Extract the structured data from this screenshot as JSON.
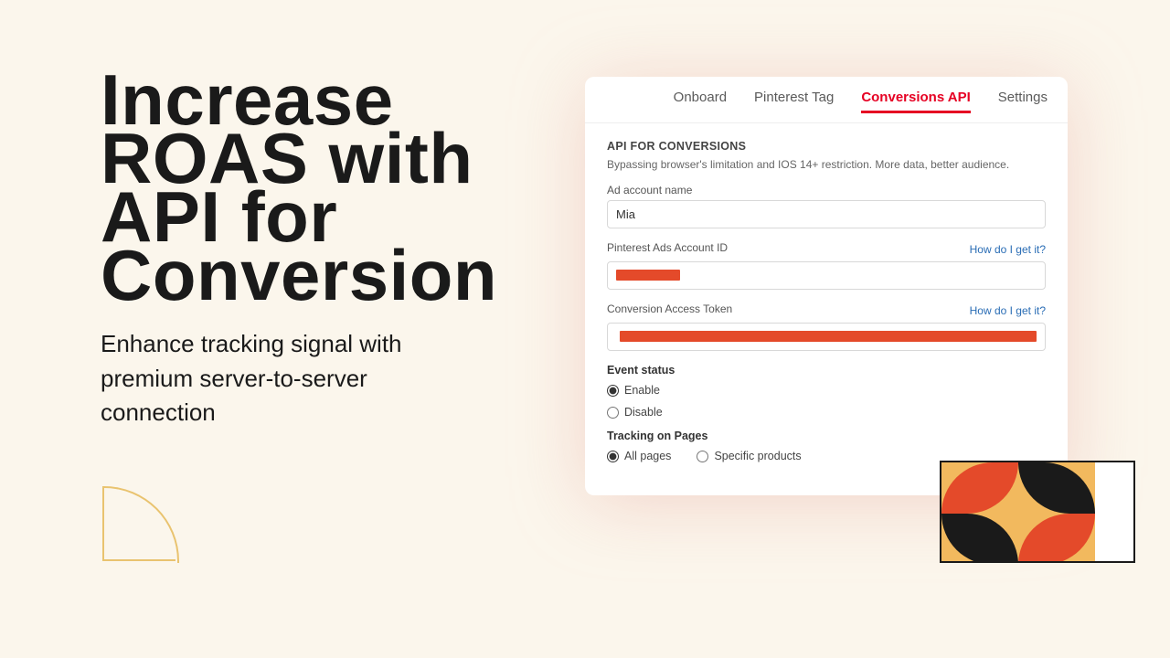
{
  "hero": {
    "headline": "Increase ROAS with API for Conversion",
    "subhead": "Enhance tracking signal with premium server-to-server connection"
  },
  "app": {
    "tabs": [
      {
        "label": "Onboard",
        "active": false
      },
      {
        "label": "Pinterest Tag",
        "active": false
      },
      {
        "label": "Conversions API",
        "active": true
      },
      {
        "label": "Settings",
        "active": false
      }
    ],
    "section": {
      "title": "API FOR CONVERSIONS",
      "desc": "Bypassing browser's limitation and IOS 14+ restriction. More data, better audience."
    },
    "fields": {
      "ad_account_name": {
        "label": "Ad account name",
        "value": "Mia"
      },
      "ads_account_id": {
        "label": "Pinterest Ads Account ID",
        "help": "How do I get it?"
      },
      "access_token": {
        "label": "Conversion Access Token",
        "help": "How do I get it?"
      }
    },
    "event_status": {
      "title": "Event status",
      "options": [
        "Enable",
        "Disable"
      ],
      "selected": "Enable"
    },
    "tracking": {
      "title": "Tracking on Pages",
      "options": [
        "All pages",
        "Specific products"
      ],
      "selected": "All pages"
    }
  }
}
